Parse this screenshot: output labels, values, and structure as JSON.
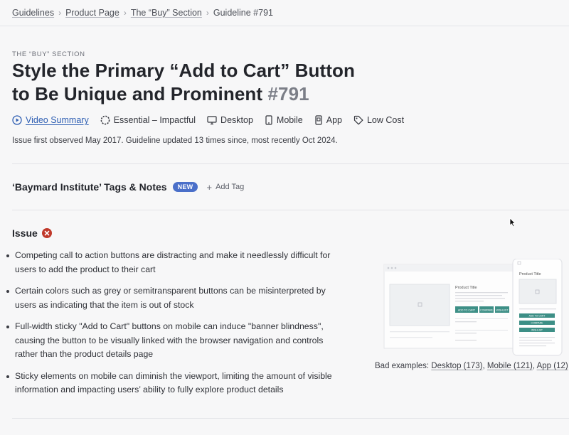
{
  "breadcrumb": {
    "items": [
      "Guidelines",
      "Product Page",
      "The “Buy” Section"
    ],
    "current": "Guideline #791"
  },
  "guideline": {
    "eyebrow": "The “Buy” Section",
    "title_line1": "Style the Primary “Add to Cart” Button",
    "title_line2": "to Be Unique and Prominent",
    "number": "#791"
  },
  "meta": {
    "video_summary": "Video Summary",
    "importance": "Essential – Impactful",
    "platforms": [
      "Desktop",
      "Mobile",
      "App"
    ],
    "cost": "Low Cost"
  },
  "issue_history": "Issue first observed May 2017. Guideline updated 13 times since, most recently Oct 2024.",
  "tags": {
    "title": "‘Baymard Institute’ Tags & Notes",
    "badge": "NEW",
    "add_tag": "Add Tag"
  },
  "issue": {
    "heading": "Issue",
    "bullets": [
      "Competing call to action buttons are distracting and make it needlessly difficult for users to add the product to their cart",
      "Certain colors such as grey or semitransparent buttons can be misinterpreted by users as indicating that the item is out of stock",
      "Full-width sticky \"Add to Cart\" buttons on mobile can induce \"banner blindness\", causing the button to be visually linked with the browser navigation and controls rather than the product details page",
      "Sticky elements on mobile can diminish the viewport, limiting the amount of visible information and impacting users’ ability to fully explore product details"
    ]
  },
  "illustration": {
    "desktop_title": "Product Title",
    "desktop_buttons": [
      "ADD TO CART",
      "COMPARE",
      "WISHLIST"
    ],
    "mobile_title": "Product Title",
    "mobile_buttons": [
      "ADD TO CART",
      "COMPARE",
      "WISHLIST"
    ]
  },
  "bad_examples": {
    "label": "Bad examples:",
    "desktop": "Desktop (173)",
    "mobile": "Mobile (121)",
    "app": "App (12)"
  },
  "colors": {
    "accent_link": "#2f5fb3",
    "badge_new": "#4a6fc9",
    "error_red": "#c0392b",
    "illustration_button": "#3d8f86"
  }
}
